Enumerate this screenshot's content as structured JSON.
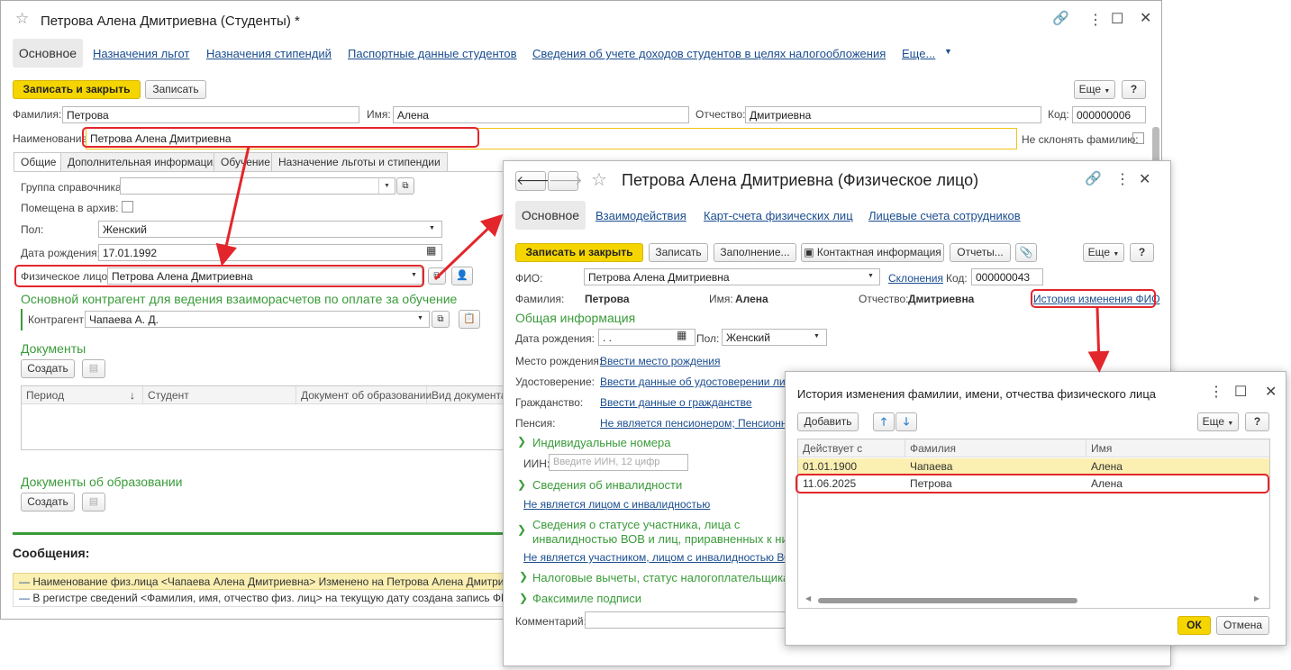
{
  "main": {
    "title": "Петрова Алена Дмитриевна (Студенты) *",
    "nav": [
      "Основное",
      "Назначения льгот",
      "Назначения стипендий",
      "Паспортные данные студентов",
      "Сведения об учете доходов студентов в целях налогообложения",
      "Еще..."
    ],
    "save_close": "Записать и закрыть",
    "save": "Записать",
    "more": "Еще",
    "help": "?",
    "familia_label": "Фамилия:",
    "familia": "Петрова",
    "imya_label": "Имя:",
    "imya": "Алена",
    "otchestvo_label": "Отчество:",
    "otchestvo": "Дмитриевна",
    "kod_label": "Код:",
    "kod": "000000006",
    "naim_label": "Наименование:",
    "naim": "Петрова Алена Дмитриевна",
    "ne_sklonyat": "Не склонять фамилию:",
    "tabs": [
      "Общие",
      "Дополнительная информация",
      "Обучение",
      "Назначение льготы и стипендии"
    ],
    "gruppa_label": "Группа справочника:",
    "archive_label": "Помещена в архив:",
    "pol_label": "Пол:",
    "pol": "Женский",
    "dr_label": "Дата рождения:",
    "dr": "17.01.1992",
    "fl_label": "Физическое лицо:",
    "fl": "Петрова Алена Дмитриевна",
    "contragent_head": "Основной контрагент для ведения взаиморасчетов по оплате за обучение",
    "contragent_label": "Контрагент:",
    "contragent": "Чапаева А. Д.",
    "docs_head": "Документы",
    "create": "Создать",
    "cols": [
      "Период",
      "Студент",
      "Документ об образовании",
      "Вид документа"
    ],
    "edu_docs_head": "Документы об образовании",
    "messages_head": "Сообщения:",
    "messages": [
      "Наименование  физ.лица <Чапаева Алена Дмитриевна> Изменено на Петрова Алена Дмитриевна!",
      "В  регистре  сведений <Фамилия, имя, отчество физ. лиц> на текущую дату  создана запись ФИО <П"
    ]
  },
  "person": {
    "title": "Петрова Алена Дмитриевна (Физическое лицо)",
    "nav": [
      "Основное",
      "Взаимодействия",
      "Карт-счета физических лиц",
      "Лицевые счета сотрудников"
    ],
    "save_close": "Записать и закрыть",
    "save": "Записать",
    "fill": "Заполнение...",
    "contact": "Контактная информация",
    "reports": "Отчеты...",
    "more": "Еще",
    "help": "?",
    "fio_label": "ФИО:",
    "fio": "Петрова Алена Дмитриевна",
    "sklon": "Склонения",
    "kod_label": "Код:",
    "kod": "000000043",
    "fam_label": "Фамилия:",
    "fam": "Петрова",
    "imya_label": "Имя:",
    "imya": "Алена",
    "otch_label": "Отчество:",
    "otch": "Дмитриевна",
    "history_link": "История изменения ФИО",
    "general": "Общая информация",
    "dr_label": "Дата рождения:",
    "dr": " .  .",
    "pol_label": "Пол:",
    "pol": "Женский",
    "mesto_label": "Место рождения:",
    "mesto": "Ввести место рождения",
    "udost_label": "Удостоверение:",
    "udost": "Ввести данные об удостоверении личности",
    "grazh_label": "Гражданство:",
    "grazh": "Ввести данные о гражданстве",
    "pension_label": "Пенсия:",
    "pension": "Не является пенсионером; Пенсионный",
    "ind_head": "Индивидуальные номера",
    "iin_label": "ИИН:",
    "iin_ph": "Введите ИИН, 12 цифр",
    "inv_head": "Сведения об инвалидности",
    "inv_link": "Не является лицом с инвалидностью",
    "vov_head1": "Сведения о статусе участника, лица с",
    "vov_head2": "инвалидностью ВОВ и лиц, приравненных к ни",
    "vov_link": "Не является участником, лицом с инвалидностью ВОВ и",
    "tax_head": "Налоговые вычеты, статус налогоплательщика",
    "fax_head": "Факсимиле подписи",
    "comment_label": "Комментарий:"
  },
  "history": {
    "title": "История изменения фамилии, имени, отчества физического лица",
    "add": "Добавить",
    "more": "Еще",
    "help": "?",
    "cols": [
      "Действует с",
      "Фамилия",
      "Имя"
    ],
    "rows": [
      [
        "01.01.1900",
        "Чапаева",
        "Алена"
      ],
      [
        "11.06.2025",
        "Петрова",
        "Алена"
      ]
    ],
    "ok": "ОК",
    "cancel": "Отмена"
  },
  "colors": {
    "accent": "#f5d500",
    "link": "#1a4d8f",
    "section": "#3a9b3a",
    "highlight": "#e3262c"
  }
}
